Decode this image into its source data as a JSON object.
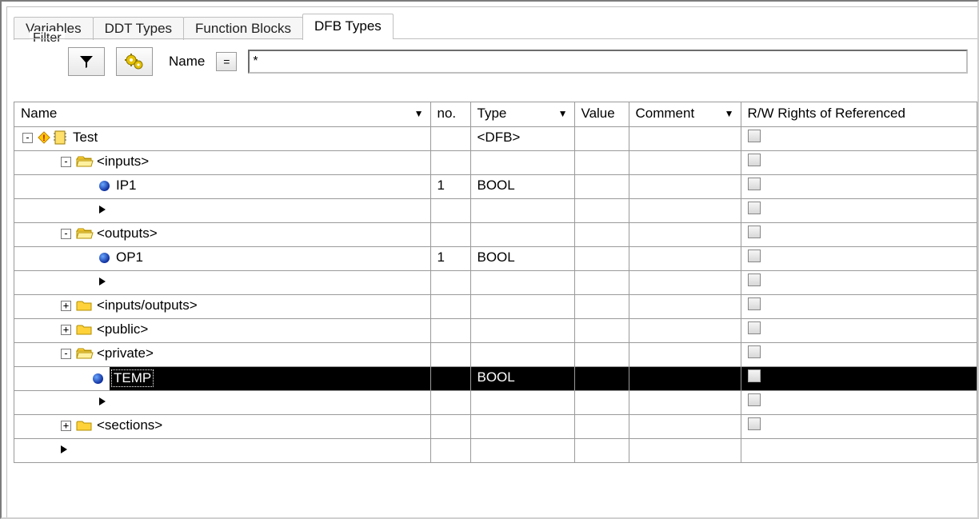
{
  "tabs": [
    {
      "label": "Variables",
      "active": false
    },
    {
      "label": "DDT Types",
      "active": false
    },
    {
      "label": "Function Blocks",
      "active": false
    },
    {
      "label": "DFB Types",
      "active": true
    }
  ],
  "filter": {
    "legend": "Filter",
    "name_label": "Name",
    "op": "=",
    "value": "*"
  },
  "columns": {
    "name": "Name",
    "no": "no.",
    "type": "Type",
    "value": "Value",
    "comment": "Comment",
    "rw": "R/W Rights of Referenced"
  },
  "rows": [
    {
      "kind": "root",
      "depth": 0,
      "exp": "-",
      "icon": "dfb",
      "name": "Test",
      "no": "",
      "type": "<DFB>",
      "rw": true
    },
    {
      "kind": "folder",
      "depth": 1,
      "exp": "-",
      "icon": "ofolder",
      "name": "<inputs>",
      "no": "",
      "type": "",
      "rw": true
    },
    {
      "kind": "var",
      "depth": 2,
      "exp": "",
      "icon": "dot",
      "name": "IP1",
      "no": "1",
      "type": "BOOL",
      "rw": true
    },
    {
      "kind": "empty",
      "depth": 2,
      "exp": "",
      "icon": "tri",
      "name": "",
      "no": "",
      "type": "",
      "rw": true
    },
    {
      "kind": "folder",
      "depth": 1,
      "exp": "-",
      "icon": "ofolder",
      "name": "<outputs>",
      "no": "",
      "type": "",
      "rw": true
    },
    {
      "kind": "var",
      "depth": 2,
      "exp": "",
      "icon": "dot",
      "name": "OP1",
      "no": "1",
      "type": "BOOL",
      "rw": true
    },
    {
      "kind": "empty",
      "depth": 2,
      "exp": "",
      "icon": "tri",
      "name": "",
      "no": "",
      "type": "",
      "rw": true
    },
    {
      "kind": "folder",
      "depth": 1,
      "exp": "+",
      "icon": "cfolder",
      "name": "<inputs/outputs>",
      "no": "",
      "type": "",
      "rw": true
    },
    {
      "kind": "folder",
      "depth": 1,
      "exp": "+",
      "icon": "cfolder",
      "name": "<public>",
      "no": "",
      "type": "",
      "rw": true
    },
    {
      "kind": "folder",
      "depth": 1,
      "exp": "-",
      "icon": "ofolder",
      "name": "<private>",
      "no": "",
      "type": "",
      "rw": true
    },
    {
      "kind": "var",
      "depth": 2,
      "exp": "",
      "icon": "dot",
      "name": "TEMP",
      "no": "",
      "type": "BOOL",
      "rw": true,
      "selected": true
    },
    {
      "kind": "empty",
      "depth": 2,
      "exp": "",
      "icon": "tri",
      "name": "",
      "no": "",
      "type": "",
      "rw": true
    },
    {
      "kind": "folder",
      "depth": 1,
      "exp": "+",
      "icon": "cfolder",
      "name": "<sections>",
      "no": "",
      "type": "",
      "rw": true
    },
    {
      "kind": "empty",
      "depth": 0,
      "exp": "",
      "icon": "tri",
      "name": "",
      "no": "",
      "type": "",
      "rw": false
    }
  ]
}
